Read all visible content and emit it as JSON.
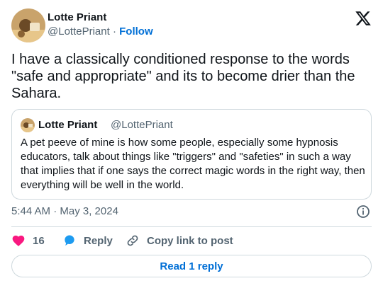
{
  "author": {
    "name": "Lotte Priant",
    "handle": "@LottePriant",
    "separator": "·",
    "follow_label": "Follow"
  },
  "brand_icon": "x-logo-icon",
  "tweet_text": "I have a classically conditioned response to the words \"safe and appropriate\" and its to become drier than the Sahara.",
  "quoted": {
    "name": "Lotte Priant",
    "handle": "@LottePriant",
    "text": "A pet peeve of mine is how some people, especially some hypnosis educators, talk about things like \"triggers\" and \"safeties\" in such a way that implies that if one says the correct magic words in the right way, then everything will be well in the world."
  },
  "timestamp": "5:44 AM · May 3, 2024",
  "actions": {
    "like_count": "16",
    "reply_label": "Reply",
    "copy_label": "Copy link to post"
  },
  "read_reply_label": "Read 1 reply",
  "colors": {
    "like": "#f91880",
    "reply": "#1d9bf0",
    "link": "#006fd6",
    "secondary_text": "#536471",
    "border": "#cfd9de"
  }
}
